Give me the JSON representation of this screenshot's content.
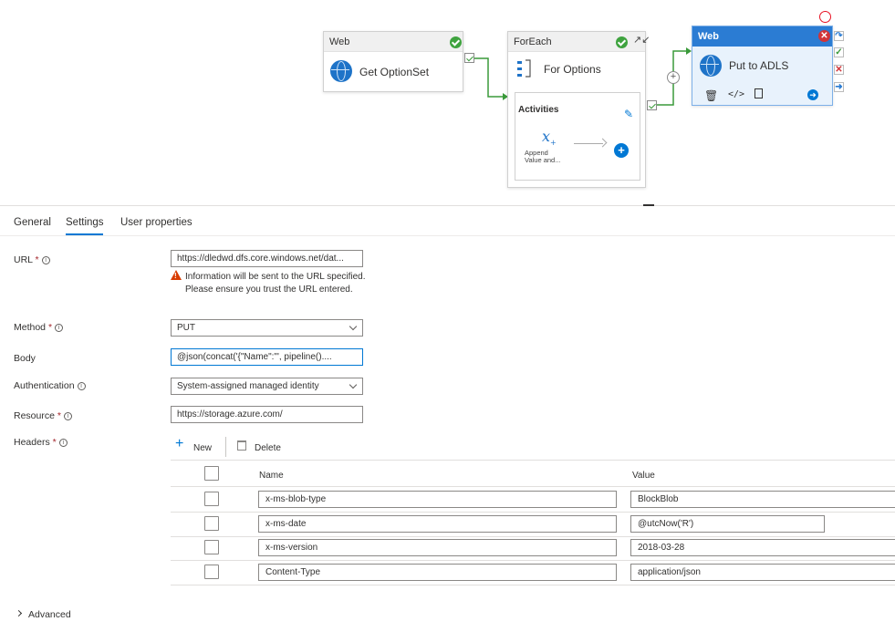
{
  "canvas": {
    "nodes": [
      {
        "type": "Web",
        "name": "Get OptionSet"
      },
      {
        "type": "ForEach",
        "name": "For Options",
        "inner_title": "Activities",
        "inner_activity": "Append\nValue and..."
      },
      {
        "type": "Web",
        "name": "Put to ADLS"
      }
    ]
  },
  "tabs": [
    {
      "label": "General"
    },
    {
      "label": "Settings"
    },
    {
      "label": "User properties"
    }
  ],
  "form": {
    "url": {
      "label": "URL",
      "value": "https://dledwd.dfs.core.windows.net/dat...",
      "warning": "Information will be sent to the URL specified. Please ensure you trust the URL entered."
    },
    "method": {
      "label": "Method",
      "value": "PUT"
    },
    "body": {
      "label": "Body",
      "value": "@json(concat('{\"Name\":\"', pipeline()...."
    },
    "authentication": {
      "label": "Authentication",
      "value": "System-assigned managed identity"
    },
    "resource": {
      "label": "Resource",
      "value": "https://storage.azure.com/"
    },
    "headers": {
      "label": "Headers",
      "new_label": "New",
      "delete_label": "Delete",
      "col_name": "Name",
      "col_value": "Value",
      "rows": [
        {
          "name": "x-ms-blob-type",
          "value": "BlockBlob"
        },
        {
          "name": "x-ms-date",
          "value": "@utcNow('R')"
        },
        {
          "name": "x-ms-version",
          "value": "2018-03-28"
        },
        {
          "name": "Content-Type",
          "value": "application/json"
        }
      ]
    },
    "required_mark": "*",
    "advanced_label": "Advanced"
  },
  "colors": {
    "accent": "#0078d4",
    "success": "#3fa33f",
    "error": "#d13438",
    "warning": "#d83b01"
  }
}
